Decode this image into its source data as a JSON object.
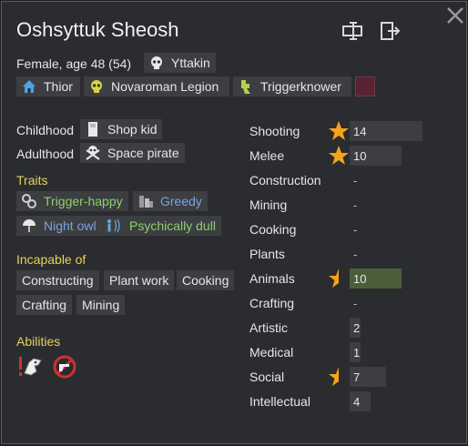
{
  "pawn": {
    "name": "Oshsyttuk Sheosh",
    "description": "Female, age 48 (54)"
  },
  "header_icons": [
    "rename-icon",
    "banish-icon",
    "close-icon"
  ],
  "ideo": {
    "label": "Yttakin",
    "icon": "skull-icon"
  },
  "factions": [
    {
      "label": "Thior",
      "icon": "house-icon",
      "color": "#4aa3e6"
    },
    {
      "label": "Novaroman Legion",
      "icon": "legion-skull-icon",
      "color": "#d8d244"
    },
    {
      "label": "Triggerknower",
      "icon": "role-icon",
      "color": "#b6d24a"
    },
    {
      "label": "",
      "icon": "favorite-color-swatch",
      "color": "#5a2333"
    }
  ],
  "backstory": {
    "childhood_label": "Childhood",
    "childhood": "Shop kid",
    "adulthood_label": "Adulthood",
    "adulthood": "Space pirate"
  },
  "traits": {
    "title": "Traits",
    "items": [
      {
        "label": "Trigger-happy",
        "color": "#8fd06b"
      },
      {
        "label": "Greedy",
        "color": "#7aa3e0"
      },
      {
        "label": "Night owl",
        "color": "#7aa3e0"
      },
      {
        "label": "Psychically dull",
        "color": "#8fd06b"
      }
    ]
  },
  "incapable": {
    "title": "Incapable of",
    "items": [
      "Constructing",
      "Plant work",
      "Cooking",
      "Crafting",
      "Mining"
    ]
  },
  "abilities": {
    "title": "Abilities"
  },
  "skills": [
    {
      "name": "Shooting",
      "level": "14",
      "value": 14,
      "passion": "major",
      "highlight": false
    },
    {
      "name": "Melee",
      "level": "10",
      "value": 10,
      "passion": "major",
      "highlight": false
    },
    {
      "name": "Construction",
      "level": "-",
      "value": 0,
      "passion": "none",
      "highlight": false
    },
    {
      "name": "Mining",
      "level": "-",
      "value": 0,
      "passion": "none",
      "highlight": false
    },
    {
      "name": "Cooking",
      "level": "-",
      "value": 0,
      "passion": "none",
      "highlight": false
    },
    {
      "name": "Plants",
      "level": "-",
      "value": 0,
      "passion": "none",
      "highlight": false
    },
    {
      "name": "Animals",
      "level": "10",
      "value": 10,
      "passion": "minor",
      "highlight": true
    },
    {
      "name": "Crafting",
      "level": "-",
      "value": 0,
      "passion": "none",
      "highlight": false
    },
    {
      "name": "Artistic",
      "level": "2",
      "value": 2,
      "passion": "none",
      "highlight": false
    },
    {
      "name": "Medical",
      "level": "1",
      "value": 1,
      "passion": "none",
      "highlight": false
    },
    {
      "name": "Social",
      "level": "7",
      "value": 7,
      "passion": "minor",
      "highlight": false
    },
    {
      "name": "Intellectual",
      "level": "4",
      "value": 4,
      "passion": "none",
      "highlight": false
    }
  ]
}
